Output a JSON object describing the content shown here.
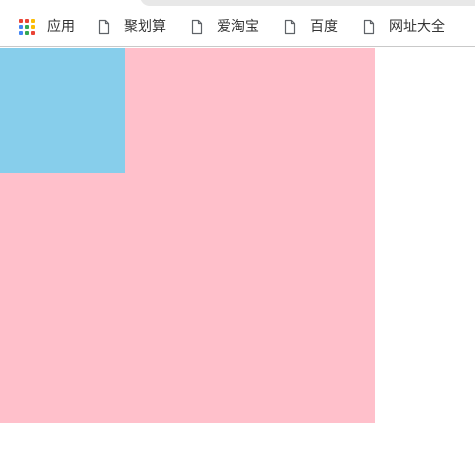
{
  "bookmarks_bar": {
    "apps": {
      "label": "应用",
      "icon": "apps-grid-icon",
      "dot_colors": [
        "#ea4335",
        "#ea4335",
        "#fbbc05",
        "#4285f4",
        "#34a853",
        "#fbbc05",
        "#4285f4",
        "#34a853",
        "#ea4335"
      ]
    },
    "items": [
      {
        "label": "聚划算",
        "icon": "page-icon"
      },
      {
        "label": "爱淘宝",
        "icon": "page-icon"
      },
      {
        "label": "百度",
        "icon": "page-icon"
      },
      {
        "label": "网址大全",
        "icon": "page-icon"
      }
    ]
  },
  "content": {
    "outer_box": {
      "color": "#ffc0cb"
    },
    "inner_box": {
      "color": "#87ceeb"
    }
  }
}
